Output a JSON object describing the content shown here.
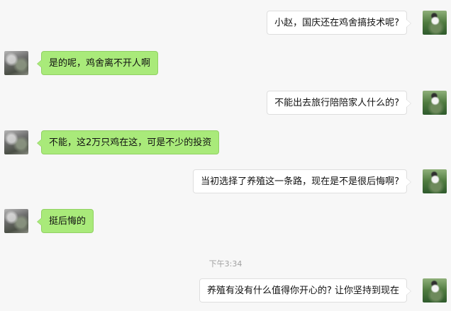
{
  "conversation": {
    "timestamp": "下午3:34",
    "messages": [
      {
        "side": "right",
        "text": "小赵，国庆还在鸡舍搞技术呢?"
      },
      {
        "side": "left",
        "text": "是的呢，鸡舍离不开人啊"
      },
      {
        "side": "right",
        "text": "不能出去旅行陪陪家人什么的?"
      },
      {
        "side": "left",
        "text": "不能，这2万只鸡在这，可是不少的投资"
      },
      {
        "side": "right",
        "text": "当初选择了养殖这一条路，现在是不是很后悔啊?"
      },
      {
        "side": "left",
        "text": "挺后悔的"
      },
      {
        "side": "right",
        "text": "养殖有没有什么值得你开心的? 让你坚持到现在"
      }
    ]
  },
  "colors": {
    "background": "#f7f7f7",
    "left_bubble": "#a9ea7a",
    "right_bubble": "#ffffff",
    "timestamp": "#a0a0a0"
  },
  "icons": {
    "left_avatar": "contact-avatar-icon",
    "right_avatar": "user-avatar-icon"
  }
}
